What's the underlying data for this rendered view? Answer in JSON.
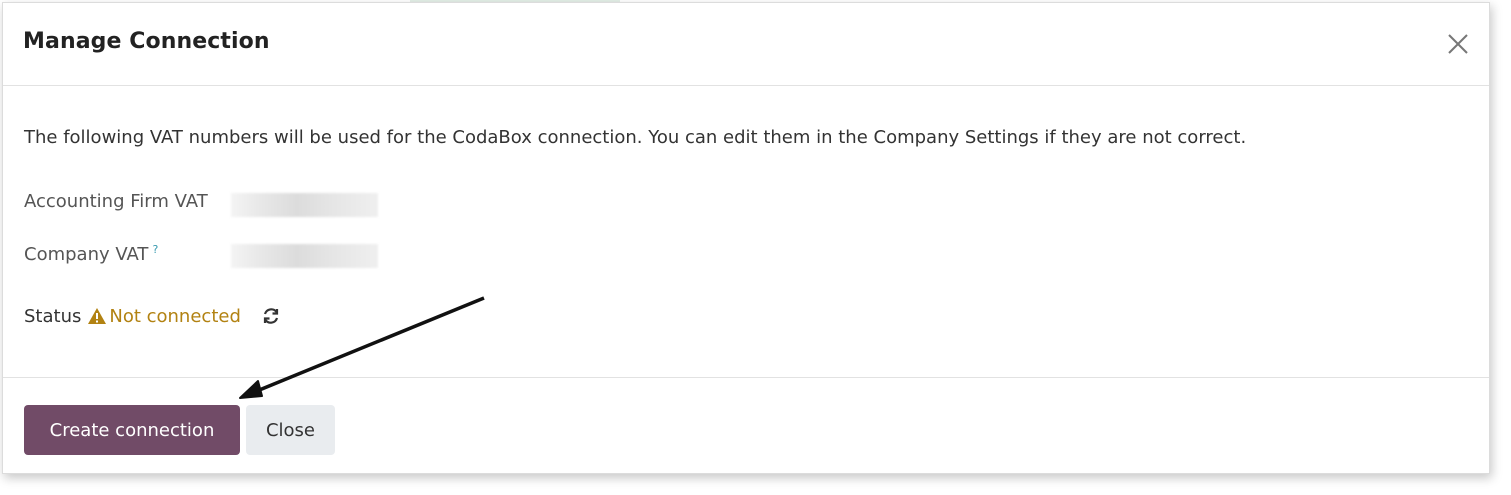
{
  "dialog": {
    "title": "Manage Connection",
    "close_icon": "close-x-icon"
  },
  "body": {
    "intro": "The following VAT numbers will be used for the CodaBox connection. You can edit them in the Company Settings if they are not correct.",
    "accounting_firm_vat_label": "Accounting Firm VAT",
    "company_vat_label": "Company VAT",
    "company_vat_help": "?",
    "status_label": "Status",
    "status_icon": "warning-triangle-icon",
    "status_value": "Not connected",
    "refresh_icon": "refresh-icon"
  },
  "footer": {
    "create_label": "Create connection",
    "close_label": "Close"
  },
  "colors": {
    "primary": "#714b67",
    "warning": "#b28212",
    "help": "#3a9bb0",
    "secondary_bg": "#e9ecef"
  }
}
